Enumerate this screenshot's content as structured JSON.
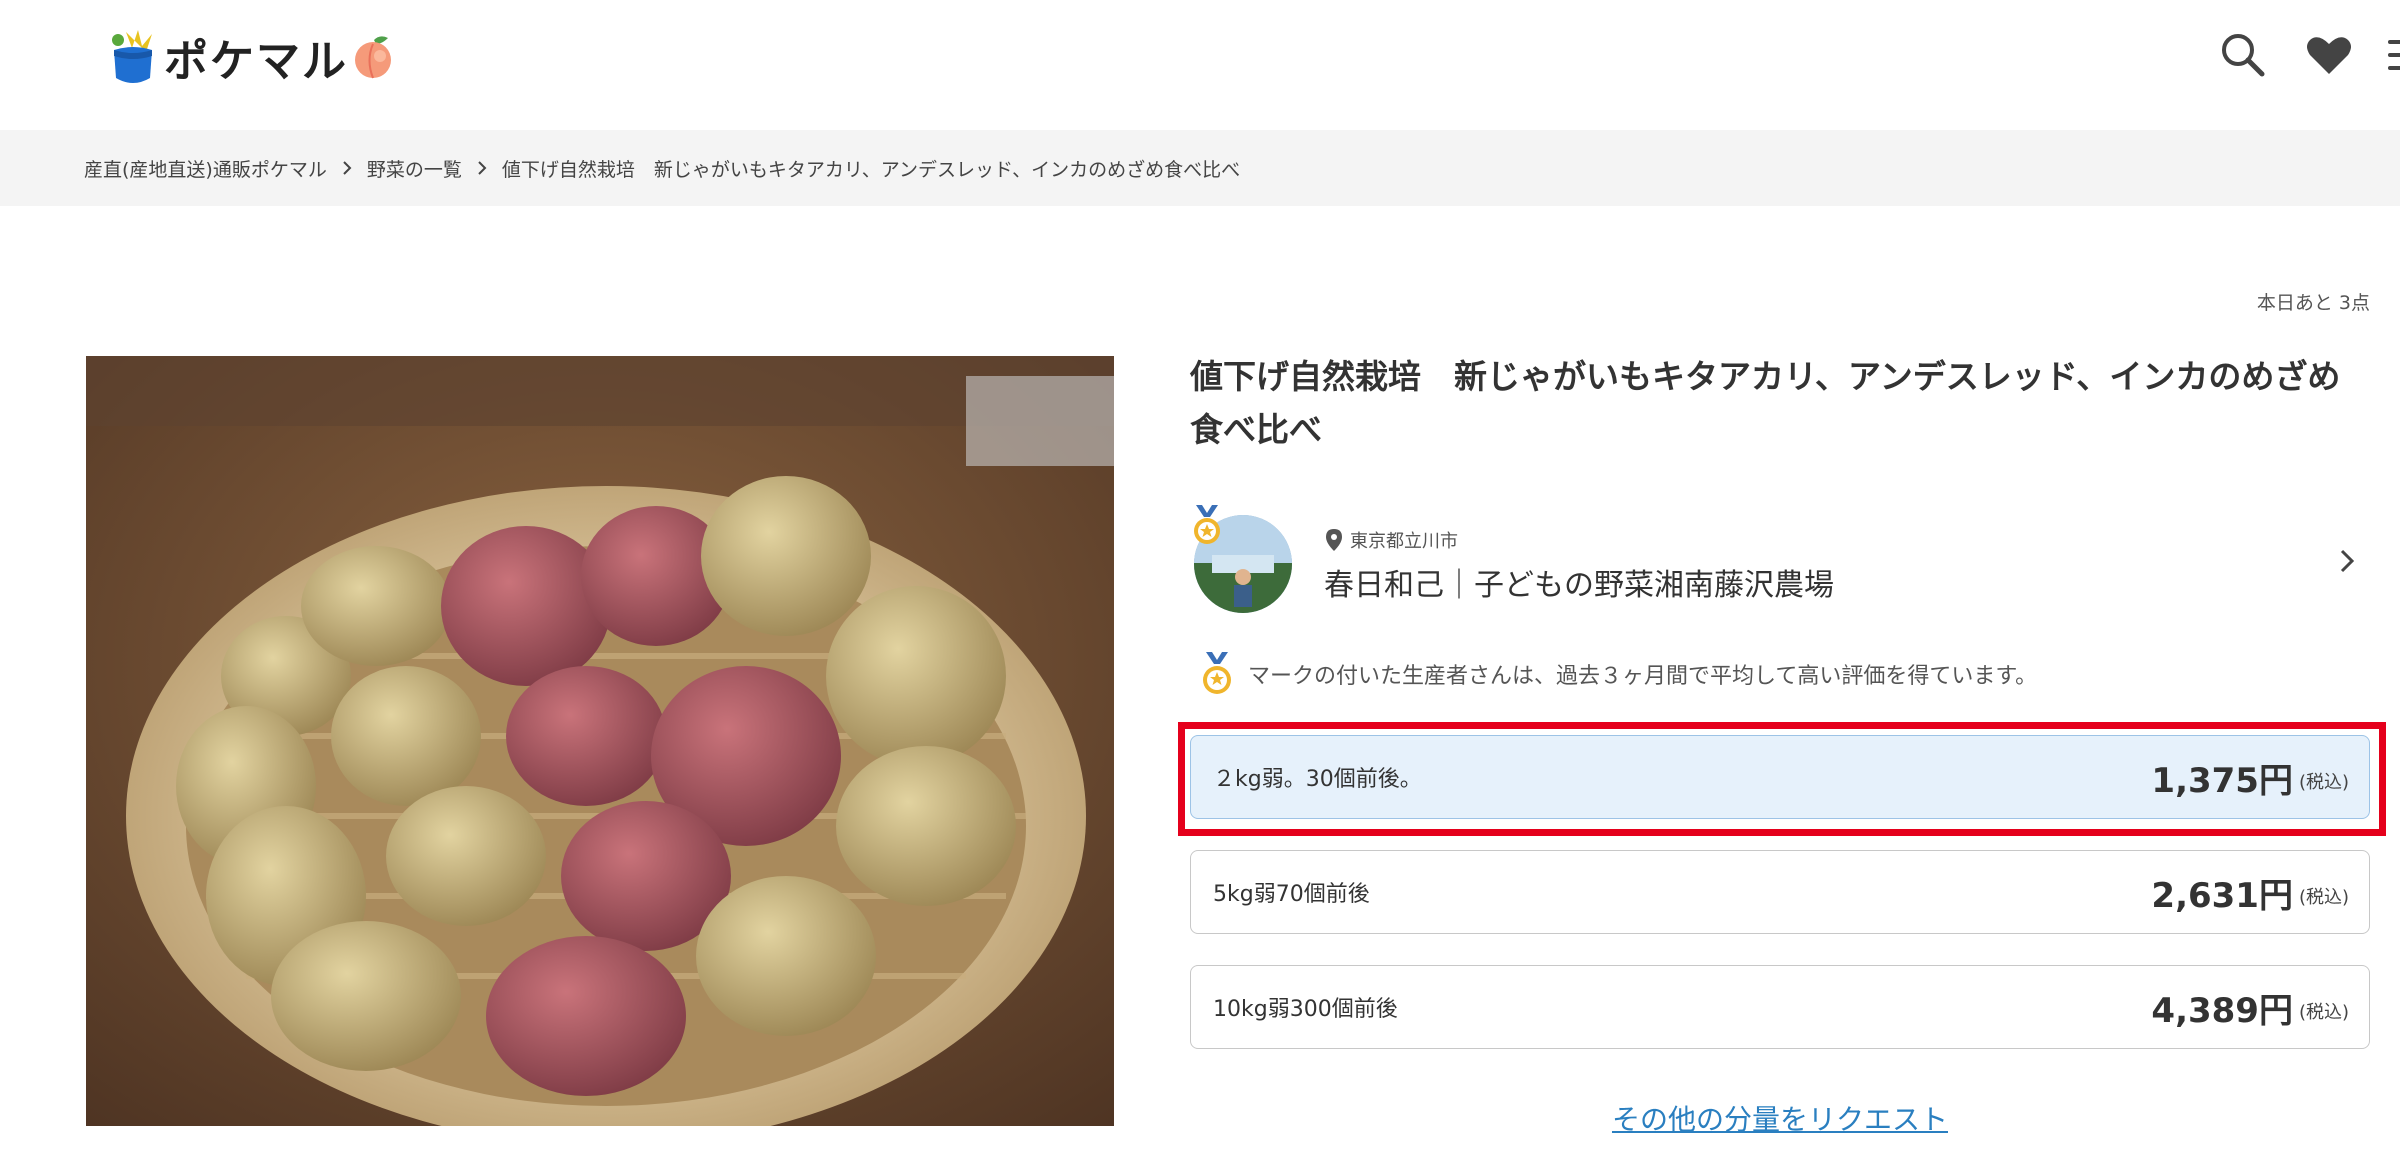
{
  "header": {
    "logo_text": "ポケマル",
    "icons": [
      "search-icon",
      "heart-icon",
      "menu-icon"
    ]
  },
  "breadcrumb": [
    "産直(産地直送)通販ポケマル",
    "野菜の一覧",
    "値下げ自然栽培　新じゃがいもキタアカリ、アンデスレッド、インカのめざめ食べ比べ"
  ],
  "product": {
    "stock_text": "本日あと 3点",
    "title": "値下げ自然栽培　新じゃがいもキタアカリ、アンデスレッド、インカのめざめ食べ比べ",
    "producer": {
      "location": "東京都立川市",
      "name": "春日和己｜子どもの野菜湘南藤沢農場"
    },
    "notice": "マークの付いた生産者さんは、過去３ヶ月間で平均して高い評価を得ています。",
    "options": [
      {
        "label": "２kg弱。30個前後。",
        "price": "1,375円",
        "tax": "(税込)",
        "selected": true
      },
      {
        "label": "5kg弱70個前後",
        "price": "2,631円",
        "tax": "(税込)",
        "selected": false
      },
      {
        "label": "10kg弱300個前後",
        "price": "4,389円",
        "tax": "(税込)",
        "selected": false
      }
    ],
    "request_link": "その他の分量をリクエスト"
  },
  "colors": {
    "accent_red": "#e5001c",
    "selected_bg": "#e6f1fb",
    "link_blue": "#2a7fc0"
  }
}
